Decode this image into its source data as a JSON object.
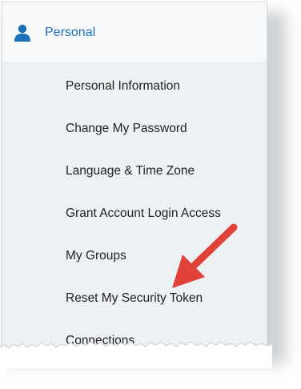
{
  "section": {
    "title": "Personal",
    "icon": "person-icon"
  },
  "menu": {
    "items": [
      {
        "label": "Personal Information"
      },
      {
        "label": "Change My Password"
      },
      {
        "label": "Language & Time Zone"
      },
      {
        "label": "Grant Account Login Access"
      },
      {
        "label": "My Groups"
      },
      {
        "label": "Reset My Security Token"
      },
      {
        "label": "Connections"
      }
    ]
  },
  "annotation": {
    "arrow_color": "#e0423a",
    "points_to": "Reset My Security Token"
  },
  "colors": {
    "accent": "#1d6fb8",
    "panel_bg": "#eef1f4"
  }
}
